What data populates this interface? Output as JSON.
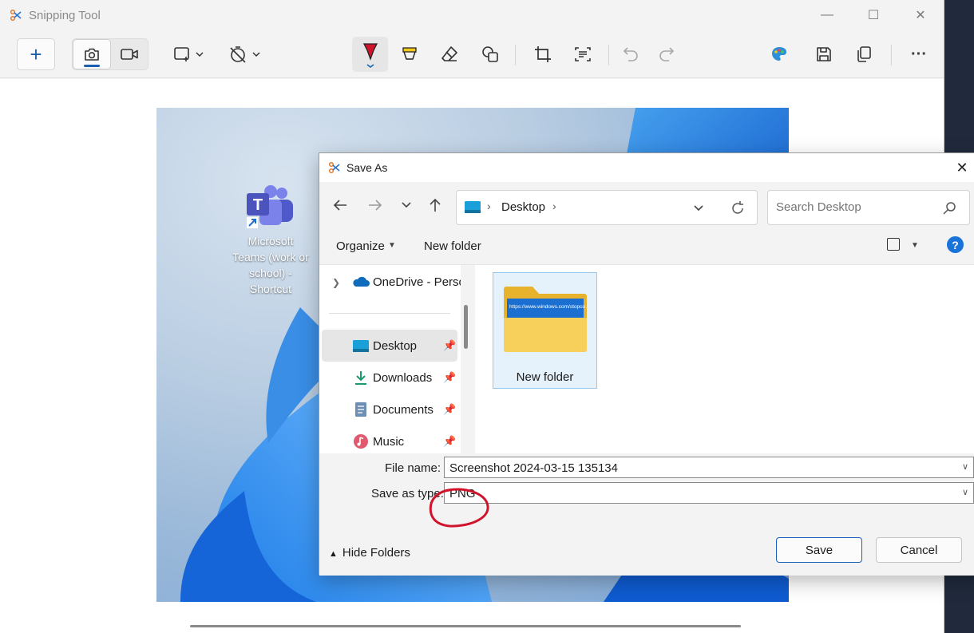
{
  "app": {
    "title": "Snipping Tool"
  },
  "window_controls": {
    "minimize": "—",
    "maximize": "☐",
    "close": "✕"
  },
  "toolbar": {
    "new_label": "+",
    "icons": [
      "camera-icon",
      "video-icon",
      "snip-shape-icon",
      "no-delay-timer-icon",
      "ballpoint-pen-icon",
      "highlighter-icon",
      "eraser-icon",
      "shapes-icon",
      "crop-icon",
      "text-actions-icon",
      "undo-icon",
      "redo-icon",
      "paint-icon",
      "save-icon",
      "copy-icon",
      "more-icon"
    ],
    "more_label": "···"
  },
  "desktop": {
    "shortcut_label": "Microsoft Teams (work or school) - Shortcut"
  },
  "dialog": {
    "title": "Save As",
    "close": "✕",
    "address": {
      "location": "Desktop"
    },
    "search": {
      "placeholder": "Search Desktop"
    },
    "commands": {
      "organize": "Organize",
      "new_folder": "New folder",
      "help": "?"
    },
    "nav_items": [
      {
        "label": "OneDrive - Personal",
        "icon": "onedrive-icon"
      },
      {
        "label": "Desktop",
        "icon": "desktop-folder-icon",
        "pinned": true,
        "selected": true
      },
      {
        "label": "Downloads",
        "icon": "downloads-icon",
        "pinned": true
      },
      {
        "label": "Documents",
        "icon": "documents-icon",
        "pinned": true
      },
      {
        "label": "Music",
        "icon": "music-icon",
        "pinned": true
      }
    ],
    "items": [
      {
        "label": "New folder",
        "thumbnail_text": "https://www.windows.com/stopco"
      }
    ],
    "file_name": {
      "label": "File name:",
      "value": "Screenshot 2024-03-15 135134"
    },
    "save_type": {
      "label": "Save as type:",
      "value": "PNG"
    },
    "hide_folders": "Hide Folders",
    "save_button": "Save",
    "cancel_button": "Cancel"
  },
  "colors": {
    "accent": "#1a62b5",
    "annotation": "#d0142c",
    "help": "#1a73d9"
  }
}
